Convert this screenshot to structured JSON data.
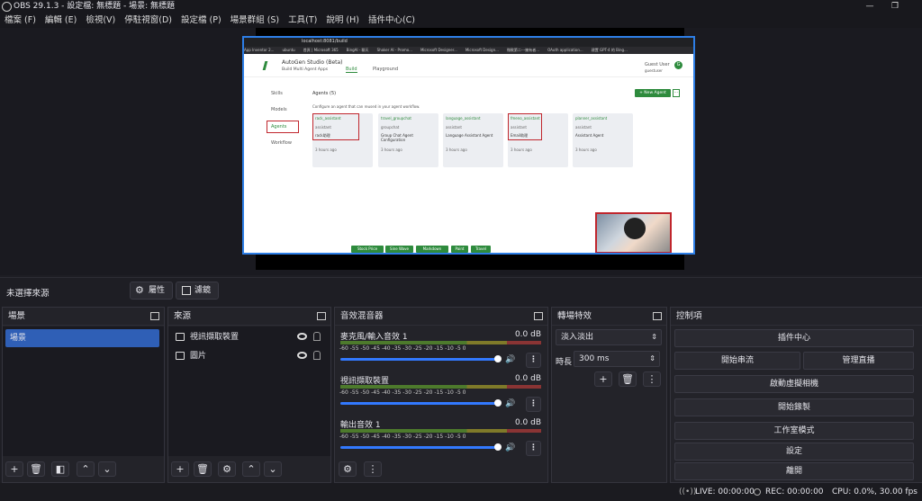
{
  "window": {
    "title": "OBS 29.1.3 - 設定檔: 無標題 - 場景: 無標題"
  },
  "menu": [
    "檔案 (F)",
    "編輯 (E)",
    "檢視(V)",
    "停駐視窗(D)",
    "設定檔 (P)",
    "場景群組 (S)",
    "工具(T)",
    "說明 (H)",
    "插件中心(C)"
  ],
  "preview": {
    "url": "localhost:8081/build",
    "bookmarks": [
      "App Inventor 2...",
      "ubuntu",
      "首頁 | Microsoft 365",
      "BingAI - 聊天",
      "Shaker AI - Promo...",
      "Microsoft Designer...",
      "Microsoft Design...",
      "微軟第二---擁有者...",
      "OAuth application...",
      "建置 GPT-4 的 Bing..."
    ],
    "app_title": "AutoGen Studio (Beta)",
    "app_subtitle": "Build Multi Agent Apps",
    "tabs": [
      "Build",
      "Playground"
    ],
    "user": "Guest User",
    "user_sub": "guestuser",
    "avatar_letter": "G",
    "side_items": [
      "Skills",
      "Models",
      "Agents",
      "Workflow"
    ],
    "section_title": "Agents (5)",
    "section_desc": "Configure an agent that can reused in your agent workflow.",
    "new_agent": "+ New Agent",
    "cards": [
      {
        "name": "rack_assistant",
        "type": "assistant",
        "desc": "rack助理",
        "time": "3 hours ago"
      },
      {
        "name": "travel_groupchat",
        "type": "groupchat",
        "desc": "Group Chat Agent Configuration",
        "time": "3 hours ago"
      },
      {
        "name": "language_assistant",
        "type": "assistant",
        "desc": "Language Assistant Agent",
        "time": "3 hours ago"
      },
      {
        "name": "fmeno_assistant",
        "type": "assistant",
        "desc": "Email助理",
        "time": "3 hours ago"
      },
      {
        "name": "planner_assistant",
        "type": "assistant",
        "desc": "Assistant Agent",
        "time": "3 hours ago"
      }
    ],
    "bottom_buttons": [
      "Stock Price",
      "Sine Wave",
      "Markdown",
      "Paint",
      "Travel"
    ]
  },
  "source_bar": {
    "no_source": "未選擇來源",
    "properties": "屬性",
    "filters": "濾鏡"
  },
  "docks": {
    "scenes": {
      "title": "場景",
      "items": [
        "場景"
      ]
    },
    "sources": {
      "title": "來源",
      "items": [
        "視訊擷取裝置",
        "圖片"
      ]
    },
    "mixer": {
      "title": "音效混音器",
      "scale": "-60 -55 -50 -45 -40 -35 -30 -25 -20 -15 -10 -5 0",
      "channels": [
        {
          "name": "麥克風/輸入音效 1",
          "db": "0.0 dB"
        },
        {
          "name": "視訊擷取裝置",
          "db": "0.0 dB"
        },
        {
          "name": "輸出音效 1",
          "db": "0.0 dB"
        }
      ]
    },
    "transitions": {
      "title": "轉場特效",
      "selected": "淡入淡出",
      "duration_label": "時長",
      "duration": "300 ms"
    },
    "controls": {
      "title": "控制項",
      "plugin_center": "插件中心",
      "start_stream": "開始串流",
      "manage_stream": "管理直播",
      "virtual_cam": "啟動虛擬相機",
      "start_record": "開始錄製",
      "studio_mode": "工作室模式",
      "settings": "設定",
      "exit": "離開"
    }
  },
  "status": {
    "live": "LIVE: 00:00:00",
    "rec": "REC: 00:00:00",
    "cpu": "CPU: 0.0%, 30.00 fps"
  },
  "colors": {
    "accent": "#2f5fb6",
    "green": "#2e8b3d",
    "selection": "#2d7ee6"
  }
}
